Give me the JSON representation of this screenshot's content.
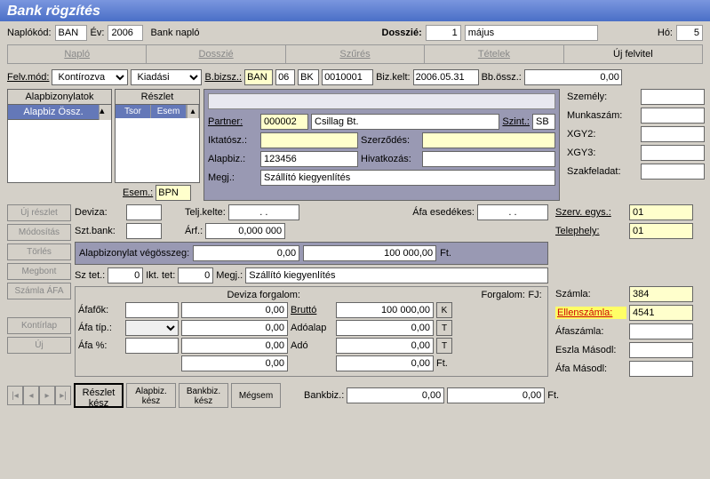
{
  "title": "Bank rögzítés",
  "header": {
    "naplokod_label": "Naplókód:",
    "naplokod": "BAN",
    "ev_label": "Év:",
    "ev": "2006",
    "naplo_name": "Bank napló",
    "dosszie_label": "Dosszié:",
    "dosszie": "1",
    "honap": "május",
    "ho_label": "Hó:",
    "ho": "5"
  },
  "tabs": {
    "naplo": "Napló",
    "dosszie": "Dosszié",
    "szures": "Szűrés",
    "tetelek": "Tételek",
    "ujfelvitel": "Új felvitel"
  },
  "row1": {
    "felvmod_label": "Felv.mód:",
    "felvmod": "Kontírozva",
    "kiadasi": "Kiadási",
    "bbizsz_label": "B.bizsz.:",
    "bbizsz1": "BAN",
    "bbizsz2": "06",
    "bbizsz3": "BK",
    "bbizsz4": "0010001",
    "bizkelt_label": "Biz.kelt:",
    "bizkelt": "2006.05.31",
    "bbossz_label": "Bb.össz.:",
    "bbossz": "0,00"
  },
  "tables": {
    "alapbiz_title": "Alapbizonylatok",
    "alapbiz_col": "Alapbiz Össz.",
    "reszlet_title": "Részlet",
    "tsor": "Tsor",
    "esem": "Esem",
    "esem_label": "Esem.:",
    "esem_val": "BPN"
  },
  "mid": {
    "partner_label": "Partner:",
    "partner_code": "000002",
    "partner_name": "Csillag Bt.",
    "szint_label": "Szint.:",
    "szint": "SB",
    "iktatosz_label": "Iktatósz.:",
    "iktatosz": "",
    "szerzodes_label": "Szerződés:",
    "szerzodes": "",
    "alapbiz_label": "Alapbiz.:",
    "alapbiz": "123456",
    "hivatkozas_label": "Hivatkozás:",
    "hivatkozas": "",
    "megj_label": "Megj.:",
    "megj": "Szállító kiegyenlítés"
  },
  "right": {
    "szemely": "Személy:",
    "munkaszam": "Munkaszám:",
    "xgy2": "XGY2:",
    "xgy3": "XGY3:",
    "szakfeladat": "Szakfeladat:",
    "szervegys": "Szerv. egys.:",
    "szervegys_val": "01",
    "telephely": "Telephely:",
    "telephely_val": "01",
    "szamla": "Számla:",
    "szamla_val": "384",
    "ellenszamla": "Ellenszámla:",
    "ellenszamla_val": "4541",
    "afaszamla": "Áfaszámla:",
    "eszla": "Eszla Másodl:",
    "afa_masodl": "Áfa Másodl:"
  },
  "lower": {
    "deviza_label": "Deviza:",
    "teljkelte_label": "Telj.kelte:",
    "teljkelte": ". .",
    "afaesedekes_label": "Áfa esedékes:",
    "afaesedekes": ". .",
    "sztbank_label": "Szt.bank:",
    "arf_label": "Árf.:",
    "arf": "0,000 000",
    "alapbiz_vegosszeg_label": "Alapbizonylat végösszeg:",
    "av1": "0,00",
    "av2": "100 000,00",
    "ft": "Ft.",
    "sztet_label": "Sz tet.:",
    "sztet": "0",
    "ikttet_label": "Ikt. tet:",
    "ikttet": "0",
    "megj_label": "Megj.:",
    "megj": "Szállító kiegyenlítés",
    "deviza_forgalom": "Deviza forgalom:",
    "forgalom": "Forgalom:",
    "fj": "FJ:",
    "afafok": "Áfafők:",
    "afatip": "Áfa típ.:",
    "afapct": "Áfa %:",
    "brutto": "Bruttó",
    "adoalap": "Adóalap",
    "ado": "Adó",
    "v000": "0,00",
    "v100k": "100 000,00",
    "bankbiz_label": "Bankbiz.:"
  },
  "fj_buttons": {
    "k": "K",
    "t": "T",
    "t2": "T"
  },
  "btns": {
    "ujreszlet": "Új részlet",
    "modositas": "Módosítás",
    "torles": "Törlés",
    "megbont": "Megbont",
    "szamlaafa": "Számla ÁFA",
    "kontirlap": "Kontírlap",
    "uj": "Új",
    "reszletkesz": "Részlet kész",
    "alapbizkesz": "Alapbiz. kész",
    "bankbizkesz": "Bankbiz. kész",
    "megsem": "Mégsem"
  }
}
